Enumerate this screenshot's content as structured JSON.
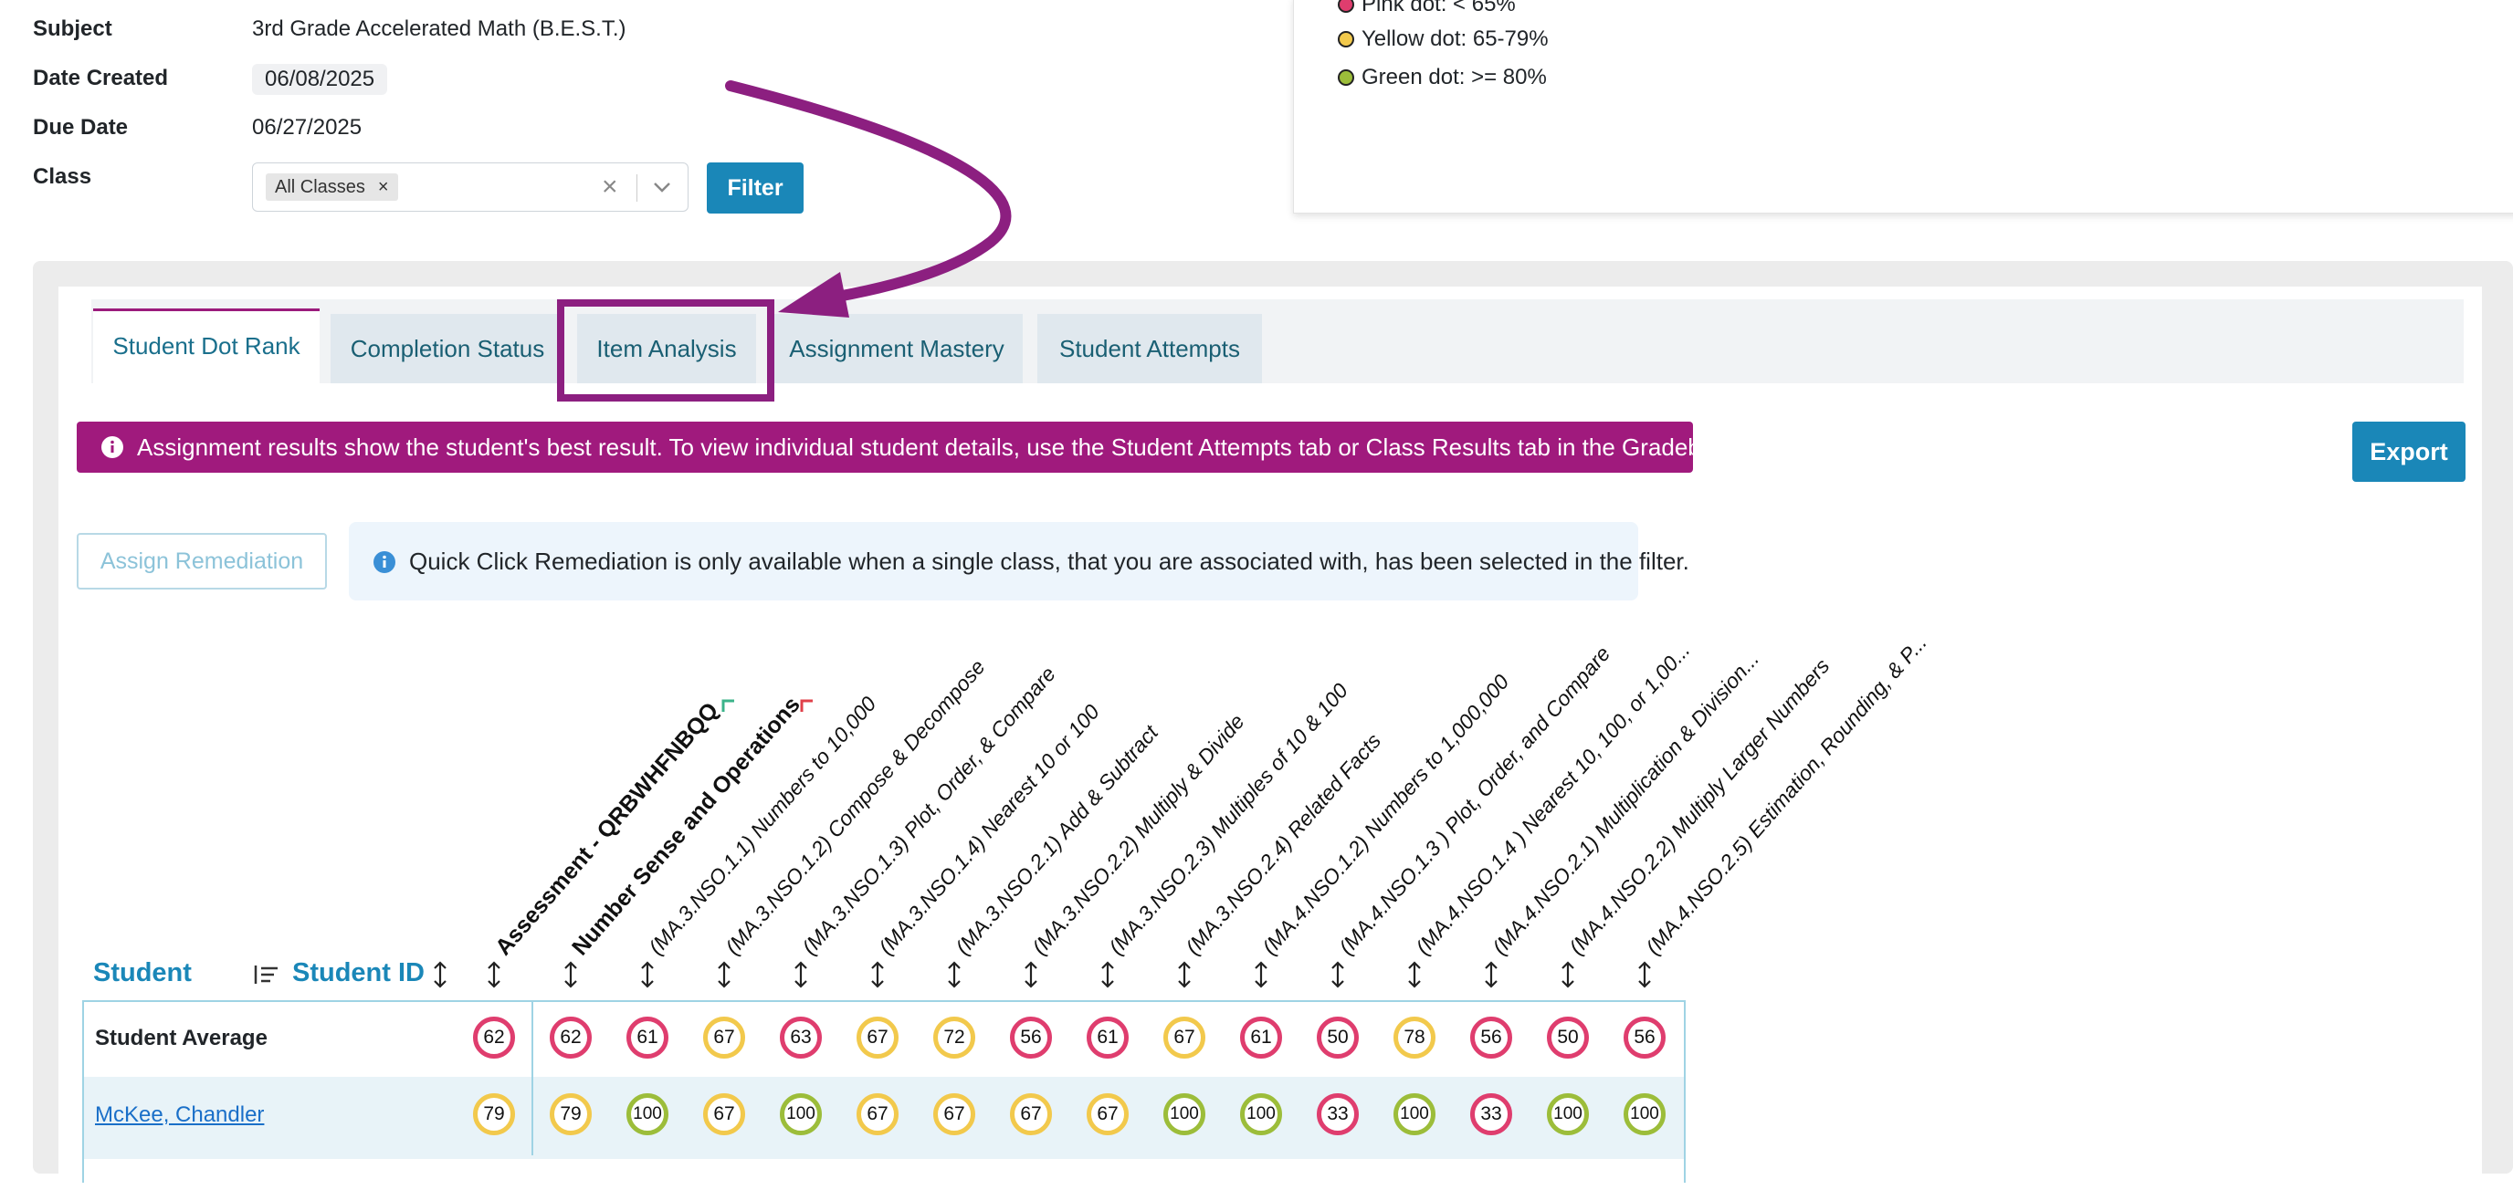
{
  "details": {
    "subject_label": "Subject",
    "subject_value": "3rd Grade Accelerated Math (B.E.S.T.)",
    "date_created_label": "Date Created",
    "date_created_value": "06/08/2025",
    "due_date_label": "Due Date",
    "due_date_value": "06/27/2025",
    "class_label": "Class",
    "class_chip": "All Classes",
    "chip_remove": "×",
    "clear_symbol": "×",
    "filter_button": "Filter"
  },
  "legend": {
    "pink": {
      "text": "Pink dot: < 65%",
      "color": "#df3d6e"
    },
    "yellow": {
      "text": "Yellow dot: 65-79%",
      "color": "#f2c94c"
    },
    "green": {
      "text": "Green dot: >= 80%",
      "color": "#9cbd3a"
    }
  },
  "tabs": [
    {
      "label": "Student Dot Rank",
      "active": true
    },
    {
      "label": "Completion Status",
      "active": false
    },
    {
      "label": "Item Analysis",
      "active": false
    },
    {
      "label": "Assignment Mastery",
      "active": false
    },
    {
      "label": "Student Attempts",
      "active": false
    }
  ],
  "alert": {
    "text": "Assignment results show the student's best result. To view individual student details, use the Student Attempts tab or Class Results tab in the Gradebook."
  },
  "export_button": "Export",
  "remediation": {
    "button": "Assign Remediation",
    "info": "Quick Click Remediation is only available when a single class, that you are associated with, has been selected in the filter."
  },
  "table": {
    "student_header": "Student",
    "student_id_header": "Student ID",
    "columns": [
      "Assessment - QRBWHFNBQQ",
      "Number Sense and Operations",
      "(MA.3.NSO.1.1) Numbers to 10,000",
      "(MA.3.NSO.1.2) Compose & Decompose",
      "(MA.3.NSO.1.3) Plot, Order, & Compare",
      "(MA.3.NSO.1.4) Nearest 10 or 100",
      "(MA.3.NSO.2.1) Add & Subtract",
      "(MA.3.NSO.2.2) Multiply & Divide",
      "(MA.3.NSO.2.3) Multiples of 10 & 100",
      "(MA.3.NSO.2.4) Related Facts",
      "(MA.4.NSO.1.2) Numbers to 1,000,000",
      "(MA.4.NSO.1.3 ) Plot, Order, and Compare",
      "(MA.4.NSO.1.4 ) Nearest 10, 100, or 1,00...",
      "(MA.4.NSO.2.1) Multiplication & Division...",
      "(MA.4.NSO.2.2) Multiply Larger Numbers",
      "(MA.4.NSO.2.5) Estimation, Rounding, & P..."
    ],
    "rows": [
      {
        "label": "Student Average",
        "values": [
          62,
          62,
          61,
          67,
          63,
          67,
          72,
          56,
          61,
          67,
          61,
          50,
          78,
          56,
          50,
          56
        ]
      },
      {
        "label": "McKee, Chandler",
        "values": [
          79,
          79,
          100,
          67,
          100,
          67,
          67,
          67,
          67,
          100,
          100,
          33,
          100,
          33,
          100,
          100
        ]
      }
    ]
  }
}
